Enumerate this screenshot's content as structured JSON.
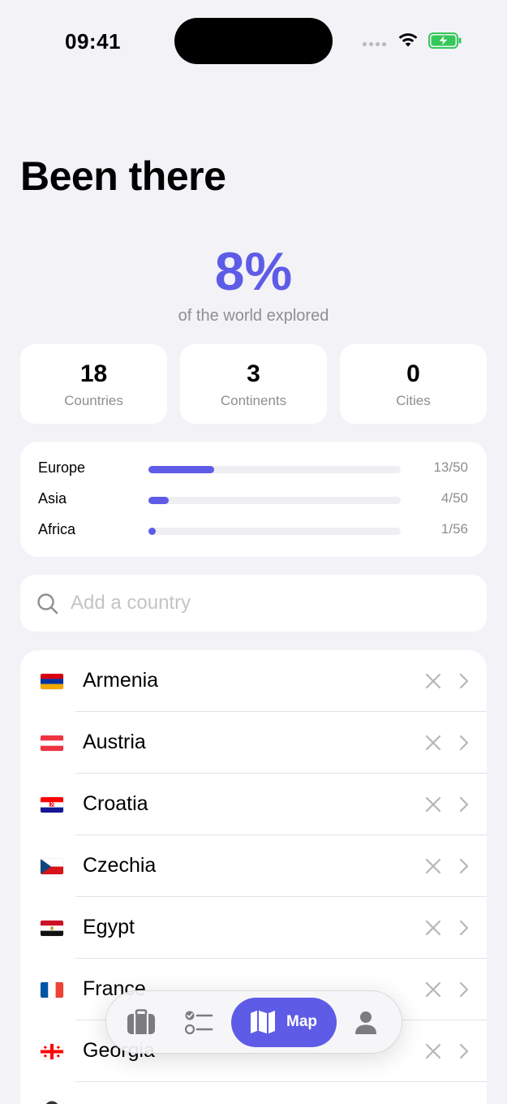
{
  "status_bar": {
    "time": "09:41"
  },
  "page": {
    "title": "Been there"
  },
  "summary": {
    "percent": "8%",
    "percent_value": 0.08,
    "caption": "of the world explored"
  },
  "stats": [
    {
      "value": "18",
      "label": "Countries"
    },
    {
      "value": "3",
      "label": "Continents"
    },
    {
      "value": "0",
      "label": "Cities"
    }
  ],
  "continents": [
    {
      "name": "Europe",
      "count": "13/50",
      "visited": 13,
      "total": 50
    },
    {
      "name": "Asia",
      "count": "4/50",
      "visited": 4,
      "total": 50
    },
    {
      "name": "Africa",
      "count": "1/56",
      "visited": 1,
      "total": 56
    }
  ],
  "search": {
    "placeholder": "Add a country"
  },
  "countries": [
    {
      "name": "Armenia",
      "flag": "armenia"
    },
    {
      "name": "Austria",
      "flag": "austria"
    },
    {
      "name": "Croatia",
      "flag": "croatia"
    },
    {
      "name": "Czechia",
      "flag": "czechia"
    },
    {
      "name": "Egypt",
      "flag": "egypt"
    },
    {
      "name": "France",
      "flag": "france"
    },
    {
      "name": "Georgia",
      "flag": "georgia"
    }
  ],
  "tab_bar": {
    "tabs": [
      {
        "name": "trips",
        "icon": "briefcase-icon"
      },
      {
        "name": "checklist",
        "icon": "checklist-icon"
      },
      {
        "name": "map",
        "icon": "map-icon",
        "label": "Map",
        "active": true
      },
      {
        "name": "profile",
        "icon": "person-icon"
      }
    ]
  },
  "colors": {
    "accent": "#5e5ce6",
    "background": "#f2f2f7",
    "secondary_text": "#8e8e93"
  }
}
